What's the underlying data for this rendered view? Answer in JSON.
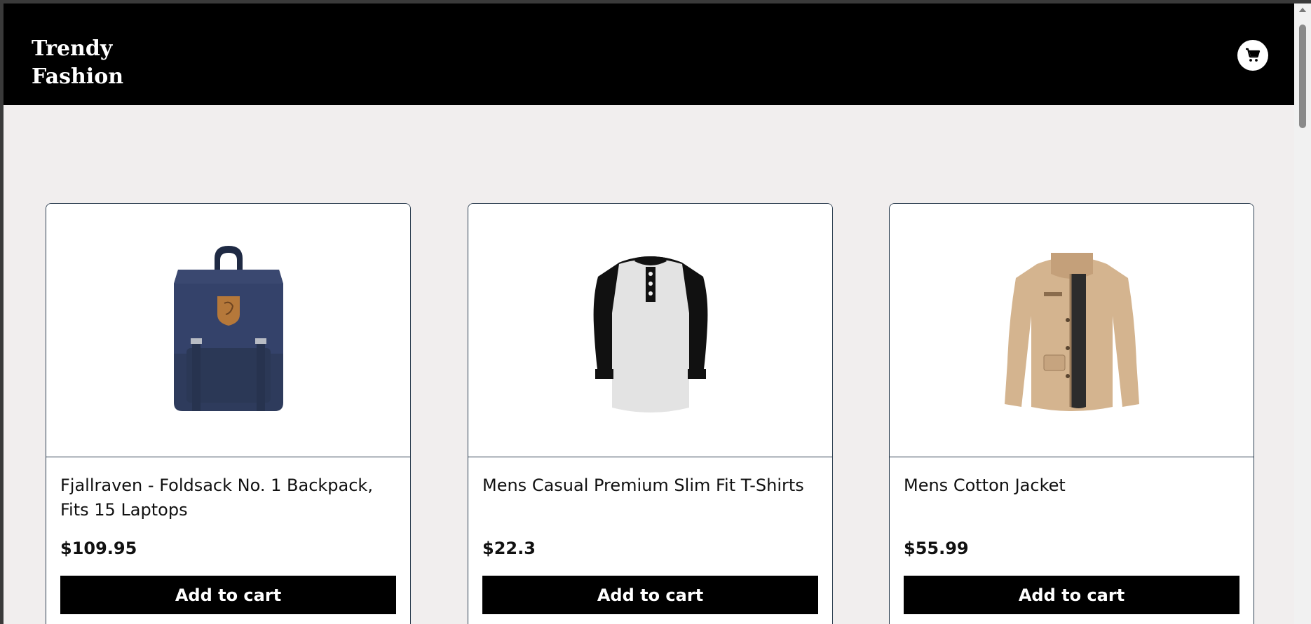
{
  "header": {
    "brand_line1": "Trendy",
    "brand_line2": "Fashion",
    "cart_icon": "shopping-cart-icon"
  },
  "products": [
    {
      "title": "Fjallraven - Foldsack No. 1 Backpack, Fits 15 Laptops",
      "price": "$109.95",
      "button_label": "Add to cart",
      "image_icon": "backpack-image"
    },
    {
      "title": "Mens Casual Premium Slim Fit T-Shirts",
      "price": "$22.3",
      "button_label": "Add to cart",
      "image_icon": "tshirt-image"
    },
    {
      "title": "Mens Cotton Jacket",
      "price": "$55.99",
      "button_label": "Add to cart",
      "image_icon": "jacket-image"
    }
  ],
  "colors": {
    "header_bg": "#000000",
    "page_bg": "#f1eeee",
    "button_bg": "#000000",
    "card_border": "#2c3e50"
  }
}
